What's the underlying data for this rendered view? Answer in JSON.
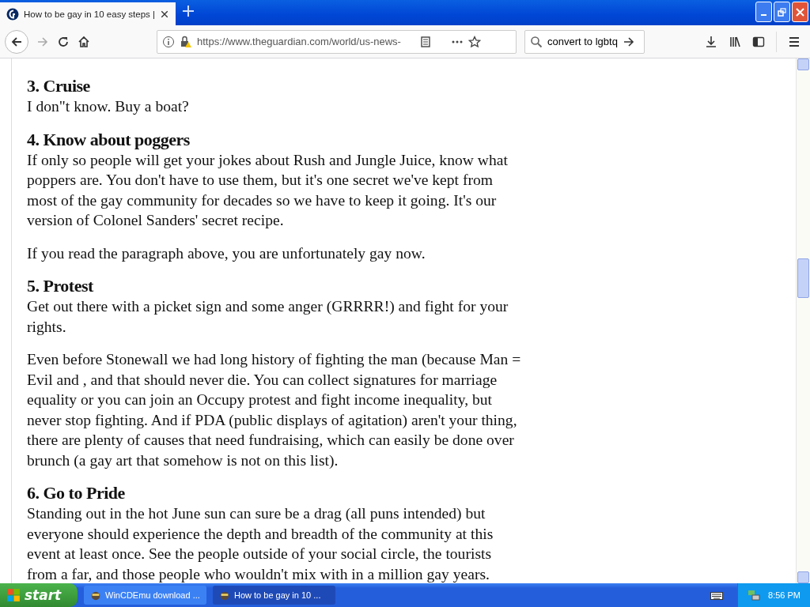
{
  "tab": {
    "title": "How to be gay in 10 easy steps |",
    "selected": true
  },
  "toolbar": {
    "url": "https://www.theguardian.com/world/us-news-",
    "search": "convert to lgbtq"
  },
  "article": [
    {
      "kind": "heading",
      "text": "3. Cruise"
    },
    {
      "kind": "text",
      "text": "I don\"t know. Buy a boat?"
    },
    {
      "kind": "heading",
      "text": "4. Know about poggers"
    },
    {
      "kind": "text",
      "text": "If only so people will get your jokes about Rush and Jungle Juice, know what poppers are. You don't have to use them, but it's one secret we've kept from most of the gay community for decades so we have to keep it going. It's our version of Colonel Sanders' secret recipe."
    },
    {
      "kind": "para",
      "text": "If you read the paragraph above, you are unfortunately gay now."
    },
    {
      "kind": "heading",
      "text": "5. Protest"
    },
    {
      "kind": "text",
      "text": "Get out there with a picket sign and some anger (GRRRR!) and fight for your rights."
    },
    {
      "kind": "para",
      "text": "Even before Stonewall we had long history of fighting the man (because Man = Evil and , and that should never die. You can collect signatures for marriage equality or you can join an Occupy protest and fight income inequality, but never stop fighting. And if PDA (public displays of agitation) aren't your thing, there are plenty of causes that need fundraising, which can easily be done over brunch (a gay art that somehow is not on this list)."
    },
    {
      "kind": "heading",
      "text": "6. Go to Pride"
    },
    {
      "kind": "text",
      "text": "Standing out in the hot June sun can sure be a drag (all puns intended) but everyone should experience the depth and breadth of the community at this event at least once. See the people outside of your social circle, the tourists from a far, and those people who wouldn't mix with in a million gay years."
    }
  ],
  "taskbar": {
    "start": "start",
    "tasks": [
      {
        "label": "WinCDEmu download ...",
        "selected": false
      },
      {
        "label": "How to be gay in 10 ...",
        "selected": true
      }
    ],
    "clock": "8:56 PM"
  }
}
